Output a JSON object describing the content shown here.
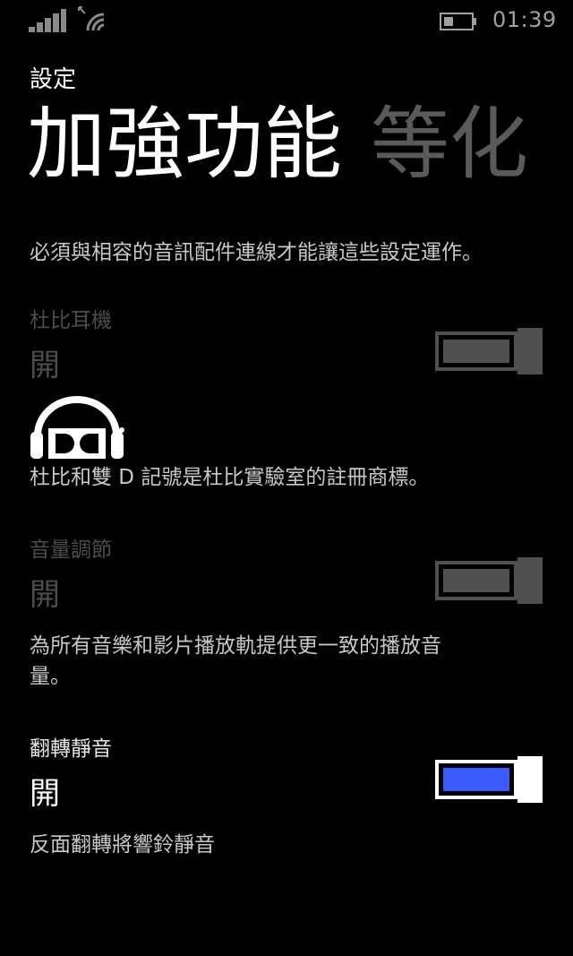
{
  "status_bar": {
    "time": "01:39",
    "icons": [
      "signal-icon",
      "wifi-icon",
      "battery-icon"
    ]
  },
  "app_title": "設定",
  "pivot": {
    "active": "加強功能",
    "next": "等化"
  },
  "intro_text": "必須與相容的音訊配件連線才能讓這些設定運作。",
  "dolby": {
    "label": "杜比耳機",
    "value": "開",
    "enabled": true,
    "available": false,
    "trademark_text": "杜比和雙 D 記號是杜比實驗室的註冊商標。"
  },
  "volume_leveling": {
    "label": "音量調節",
    "value": "開",
    "enabled": true,
    "available": false,
    "description_line1": "為所有音樂和影片播放軌提供更一致的播放音",
    "description_line2": "量。"
  },
  "flip_to_mute": {
    "label": "翻轉靜音",
    "value": "開",
    "enabled": true,
    "available": true,
    "description": "反面翻轉將響鈴靜音"
  },
  "colors": {
    "accent": "#3b5bfd",
    "disabled": "#505050",
    "background": "#000000"
  }
}
